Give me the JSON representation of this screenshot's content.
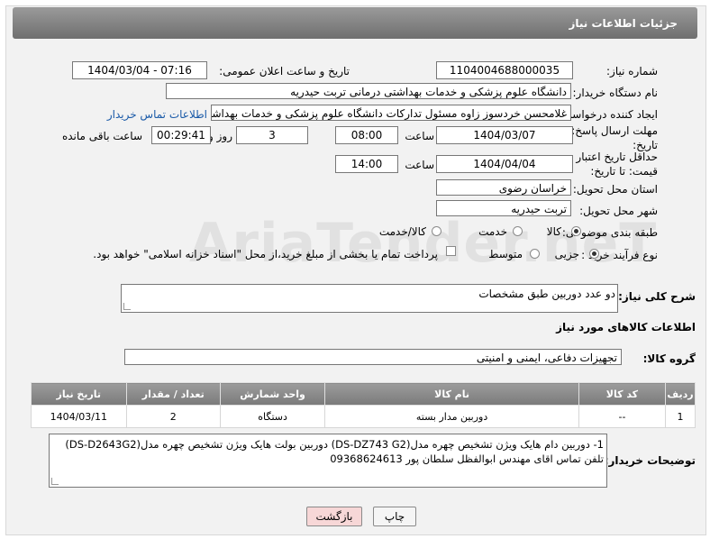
{
  "header": {
    "title": "جزئیات اطلاعات نیاز"
  },
  "fields": {
    "need_number_label": "شماره نیاز:",
    "need_number": "1104004688000035",
    "announce_label": "تاریخ و ساعت اعلان عمومی:",
    "announce_value": "1404/03/04 - 07:16",
    "buyer_org_label": "نام دستگاه خریدار:",
    "buyer_org": "دانشگاه علوم پزشکی و خدمات بهداشتی درمانی تربت حیدریه",
    "creator_label": "ایجاد کننده درخواست:",
    "creator": "غلامحسن خردسوز زاوه مسئول تدارکات دانشگاه علوم پزشکی و خدمات بهداشت",
    "buyer_contact_link": "اطلاعات تماس خریدار",
    "deadline_label": "مهلت ارسال پاسخ: تا تاریخ:",
    "deadline_date": "1404/03/07",
    "time_label": "ساعت",
    "deadline_time": "08:00",
    "days_value": "3",
    "days_label": "روز و",
    "remaining_time": "00:29:41",
    "remaining_label": "ساعت باقی مانده",
    "price_validity_label": "حداقل تاریخ اعتبار قیمت: تا تاریخ:",
    "price_validity_date": "1404/04/04",
    "price_validity_time": "14:00",
    "province_label": "استان محل تحویل:",
    "province": "خراسان رضوی",
    "city_label": "شهر محل تحویل:",
    "city": "تربت حیدریه",
    "category_label": "طبقه بندی موضوعی:",
    "category_options": [
      "کالا",
      "خدمت",
      "کالا/خدمت"
    ],
    "category_selected": "کالا",
    "process_label": "نوع فرآیند خرید :",
    "process_options": [
      "جزیی",
      "متوسط"
    ],
    "process_selected": "جزیی",
    "payment_note": "پرداخت تمام یا بخشی از مبلغ خرید،از محل \"اسناد خزانه اسلامی\" خواهد بود.",
    "summary_label": "شرح کلی نیاز:",
    "summary": "دو عدد دوربین طبق مشخصات",
    "goods_info_title": "اطلاعات کالاهای مورد نیاز",
    "goods_group_label": "گروه کالا:",
    "goods_group": "تجهیزات دفاعی، ایمنی و امنیتی",
    "buyer_notes_label": "توضیحات خریدار:",
    "buyer_notes_line1": "1- دوربین دام هایک ویژن تشخیص چهره مدل(DS-DZ743  G2) دوربین بولت هایک ویژن تشخیص چهره مدل(DS-D2643G2)",
    "buyer_notes_line2": "تلفن تماس اقای مهندس ابوالفظل سلطان پور 09368624613"
  },
  "table": {
    "headers": [
      "ردیف",
      "کد کالا",
      "نام کالا",
      "واحد شمارش",
      "تعداد / مقدار",
      "تاریخ نیاز"
    ],
    "rows": [
      [
        "1",
        "--",
        "دوربین مدار بسته",
        "دستگاه",
        "2",
        "1404/03/11"
      ]
    ]
  },
  "buttons": {
    "print": "چاپ",
    "back": "بازگشت"
  },
  "watermark": "AriaTender.neT",
  "colors": {
    "title_bar": "#7f7f7f",
    "link": "#1a5aa8",
    "back_button": "#f7d7d7"
  }
}
